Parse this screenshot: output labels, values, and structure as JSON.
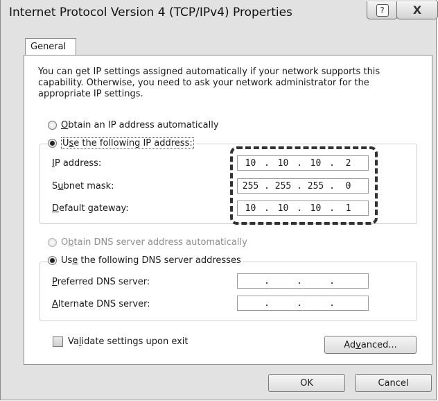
{
  "window": {
    "title": "Internet Protocol Version 4 (TCP/IPv4) Properties",
    "help_glyph": "?",
    "close_glyph": "X"
  },
  "tabs": [
    {
      "label": "General",
      "selected": true
    }
  ],
  "description": "You can get IP settings assigned automatically if your network supports this capability. Otherwise, you need to ask your network administrator for the appropriate IP settings.",
  "ip_section": {
    "auto_option": {
      "prefix": "",
      "accel": "O",
      "rest": "btain an IP address automatically",
      "selected": false
    },
    "manual_option": {
      "prefix": "U",
      "accel": "s",
      "rest": "e the following IP address:",
      "selected": true
    },
    "fields": [
      {
        "label_prefix": "",
        "accel": "I",
        "label_rest": "P address:",
        "octets": [
          "10",
          "10",
          "10",
          "2"
        ]
      },
      {
        "label_prefix": "S",
        "accel": "u",
        "label_rest": "bnet mask:",
        "octets": [
          "255",
          "255",
          "255",
          "0"
        ]
      },
      {
        "label_prefix": "",
        "accel": "D",
        "label_rest": "efault gateway:",
        "octets": [
          "10",
          "10",
          "10",
          "1"
        ]
      }
    ]
  },
  "dns_section": {
    "auto_option": {
      "prefix": "O",
      "accel": "b",
      "rest": "tain DNS server address automatically",
      "selected": false,
      "disabled": true
    },
    "manual_option": {
      "prefix": "Us",
      "accel": "e",
      "rest": " the following DNS server addresses",
      "selected": true
    },
    "fields": [
      {
        "label_prefix": "",
        "accel": "P",
        "label_rest": "referred DNS server:",
        "octets": [
          "",
          "",
          "",
          ""
        ]
      },
      {
        "label_prefix": "",
        "accel": "A",
        "label_rest": "lternate DNS server:",
        "octets": [
          "",
          "",
          "",
          ""
        ]
      }
    ]
  },
  "validate": {
    "prefix": "Va",
    "accel": "l",
    "rest": "idate settings upon exit",
    "checked": false
  },
  "buttons": {
    "advanced": {
      "prefix": "Ad",
      "accel": "v",
      "rest": "anced..."
    },
    "ok": "OK",
    "cancel": "Cancel"
  },
  "colors": {
    "dialog_bg": "#e2e2e2",
    "panel_bg": "#ffffff",
    "highlight_dash": "#333333"
  }
}
